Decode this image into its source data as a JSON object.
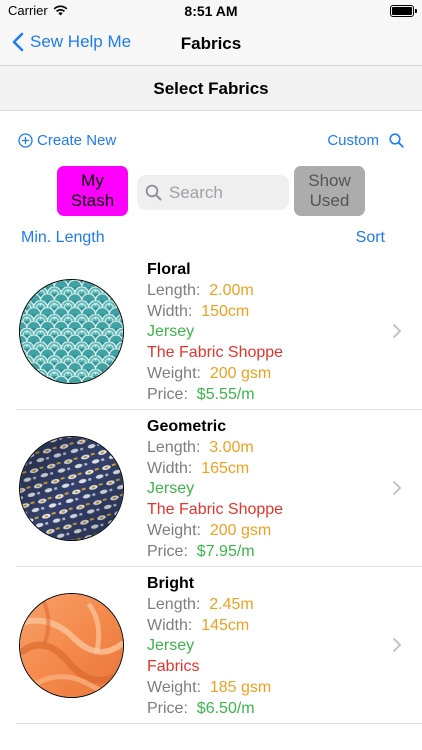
{
  "status": {
    "carrier": "Carrier",
    "time": "8:51 AM"
  },
  "nav": {
    "back_label": "Sew Help Me",
    "title": "Fabrics"
  },
  "header": {
    "title": "Select Fabrics"
  },
  "toolbar": {
    "create_new": "Create New",
    "custom": "Custom"
  },
  "filters": {
    "my_stash_line1": "My",
    "my_stash_line2": "Stash",
    "search_placeholder": "Search",
    "show_used_line1": "Show",
    "show_used_line2": "Used",
    "my_stash_color": "#ff00ff",
    "show_used_color": "#acacac"
  },
  "list_controls": {
    "min_length": "Min. Length",
    "sort": "Sort"
  },
  "labels": {
    "length": "Length:",
    "width": "Width:",
    "weight": "Weight:",
    "price": "Price:"
  },
  "fabrics": [
    {
      "name": "Floral",
      "length": "2.00m",
      "width": "150cm",
      "type": "Jersey",
      "shop": "The Fabric Shoppe",
      "weight": "200 gsm",
      "price": "$5.55/m",
      "pattern": "teal-scales"
    },
    {
      "name": "Geometric",
      "length": "3.00m",
      "width": "165cm",
      "type": "Jersey",
      "shop": "The Fabric Shoppe",
      "weight": "200 gsm",
      "price": "$7.95/m",
      "pattern": "navy-geometric"
    },
    {
      "name": "Bright",
      "length": "2.45m",
      "width": "145cm",
      "type": "Jersey",
      "shop": "Fabrics",
      "weight": "185 gsm",
      "price": "$6.50/m",
      "pattern": "orange-drape"
    }
  ],
  "colors": {
    "accent": "#1e7cf2",
    "orange": "#f0a020",
    "green": "#3cb54a",
    "red": "#e5342c"
  }
}
